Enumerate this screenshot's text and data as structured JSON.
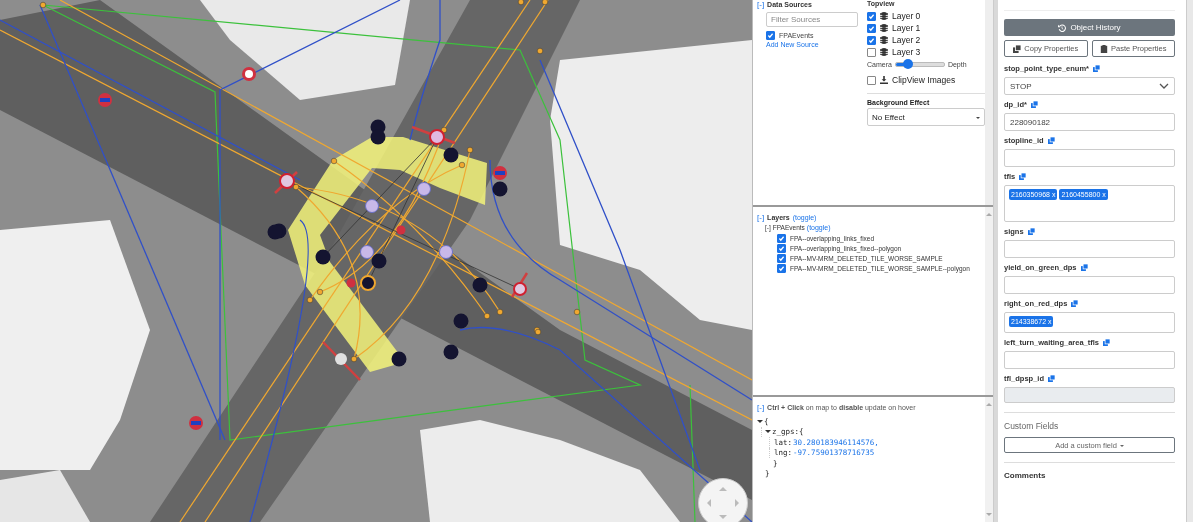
{
  "data_sources": {
    "toggle": "[-]",
    "title": "Data Sources",
    "filter_placeholder": "Filter Sources",
    "sources": [
      {
        "label": "FPAEvents",
        "checked": true
      }
    ],
    "add_link": "Add New Source"
  },
  "topview": {
    "title": "Topview",
    "layers": [
      {
        "label": "Layer 0",
        "checked": true
      },
      {
        "label": "Layer 1",
        "checked": true
      },
      {
        "label": "Layer 2",
        "checked": true
      },
      {
        "label": "Layer 3",
        "checked": false
      }
    ],
    "slider": {
      "left": "Camera",
      "right": "Depth",
      "level": 0.25
    },
    "clipview": {
      "label": "ClipView Images",
      "checked": false
    },
    "background_effect": {
      "label": "Background Effect",
      "value": "No Effect"
    }
  },
  "layers_panel": {
    "toggle": "[-]",
    "title": "Layers",
    "toggle_link": "(toggle)",
    "group": {
      "toggle": "[-]",
      "name": "FPAEvents",
      "toggle_link": "(toggle)",
      "items": [
        {
          "label": "FPA--overlapping_links_fixed",
          "checked": true
        },
        {
          "label": "FPA--overlapping_links_fixed--polygon",
          "checked": true
        },
        {
          "label": "FPA--MV-MRM_DELETED_TILE_WORSE_SAMPLE",
          "checked": true
        },
        {
          "label": "FPA--MV-MRM_DELETED_TILE_WORSE_SAMPLE--polygon",
          "checked": true
        }
      ]
    }
  },
  "inspector": {
    "toggle": "[-]",
    "hint": "**Ctrl + Click** on map to **disable** update on hover",
    "open": "{",
    "key": "z_gps",
    "key_open": ":{",
    "entries": [
      {
        "key": "lat:",
        "value": "30.280183946114576,"
      },
      {
        "key": "lng:",
        "value": "-97.75901378716735"
      }
    ],
    "inner_close": "}",
    "close": "}"
  },
  "properties": {
    "history_button": "Object History",
    "copy_button": "Copy Properties",
    "paste_button": "Paste Properties",
    "fields": [
      {
        "kind": "select",
        "label": "stop_point_type_enum*",
        "value": "STOP"
      },
      {
        "kind": "text",
        "label": "dp_id*",
        "value": "228090182"
      },
      {
        "kind": "text",
        "label": "stopline_id"
      },
      {
        "kind": "tags",
        "label": "tfls",
        "tags": [
          "2160350968 x",
          "2160455800 x"
        ]
      },
      {
        "kind": "text",
        "label": "signs"
      },
      {
        "kind": "text",
        "label": "yield_on_green_dps"
      },
      {
        "kind": "tags",
        "label": "right_on_red_dps",
        "tags": [
          "214338672 x"
        ],
        "short": true
      },
      {
        "kind": "text",
        "label": "left_turn_waiting_area_tfls"
      },
      {
        "kind": "disabled",
        "label": "tfl_dpsp_id"
      }
    ],
    "custom_fields": "Custom Fields",
    "add_custom": "Add a custom field",
    "comments": "Comments"
  }
}
